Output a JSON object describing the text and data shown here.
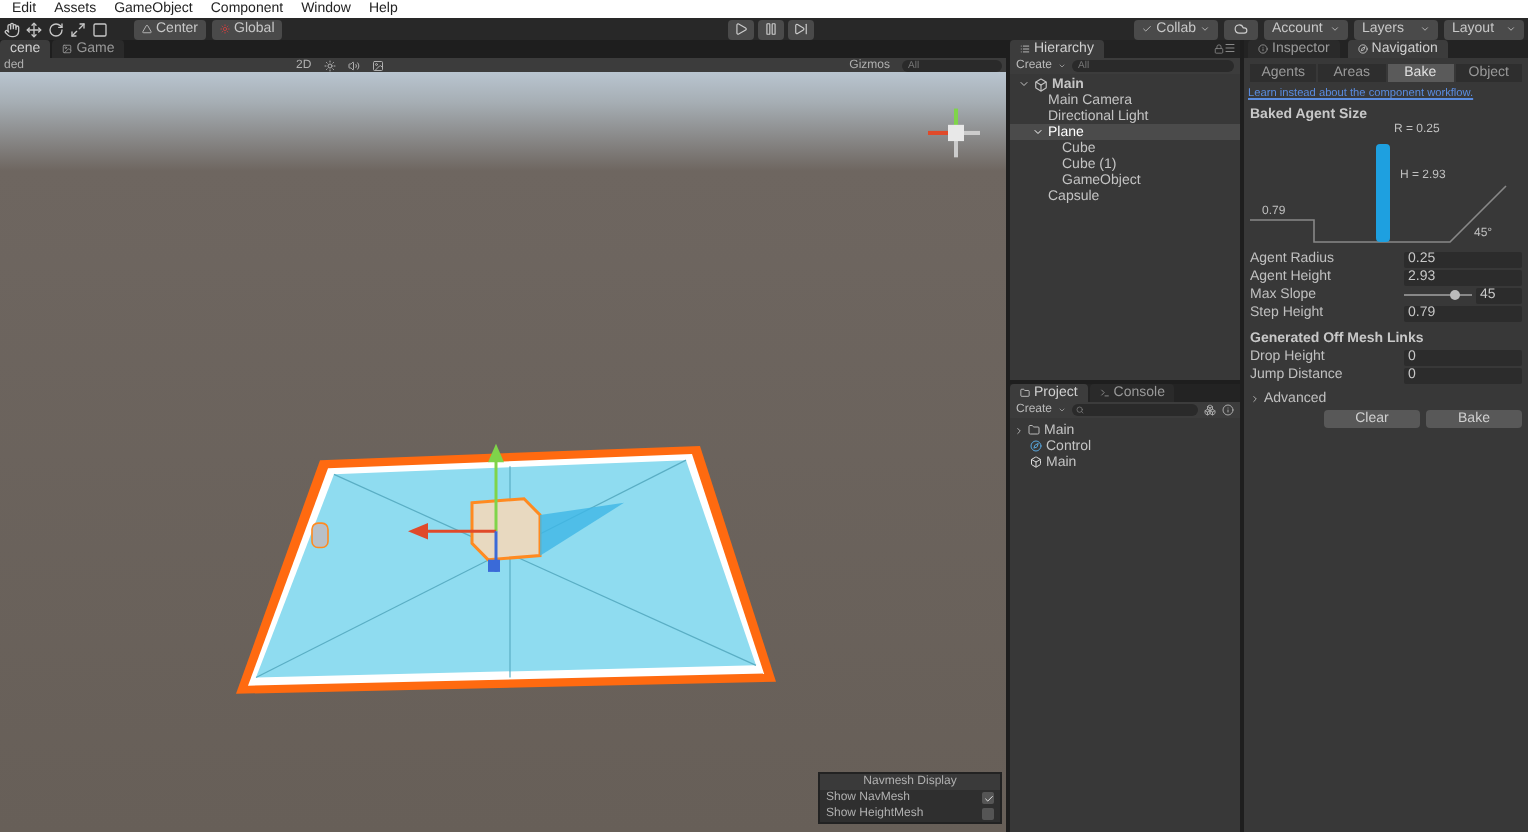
{
  "menu": [
    "Edit",
    "Assets",
    "GameObject",
    "Component",
    "Window",
    "Help"
  ],
  "toolbar": {
    "pivot": "Center",
    "space": "Global",
    "collab": "Collab",
    "account": "Account",
    "layers": "Layers",
    "layout": "Layout"
  },
  "scene": {
    "tabs": [
      {
        "label": "cene",
        "selected": true
      },
      {
        "label": "Game",
        "selected": false
      }
    ],
    "shading": "ded",
    "mode_2d": "2D",
    "gizmos": "Gizmos",
    "search_placeholder": "All"
  },
  "navmesh_display": {
    "title": "Navmesh Display",
    "options": [
      {
        "label": "Show NavMesh",
        "checked": true
      },
      {
        "label": "Show HeightMesh",
        "checked": false
      }
    ]
  },
  "hierarchy": {
    "title": "Hierarchy",
    "create": "Create",
    "search_placeholder": "All",
    "items": [
      {
        "label": "Main",
        "kind": "scene",
        "selected": false,
        "expanded": true,
        "children": [
          {
            "label": "Main Camera",
            "selected": false
          },
          {
            "label": "Directional Light",
            "selected": false
          },
          {
            "label": "Plane",
            "selected": true,
            "expanded": true,
            "children": [
              {
                "label": "Cube",
                "selected": false
              },
              {
                "label": "Cube (1)",
                "selected": false
              },
              {
                "label": "GameObject",
                "selected": false
              }
            ]
          },
          {
            "label": "Capsule",
            "selected": false
          }
        ]
      }
    ]
  },
  "project": {
    "tabs": [
      {
        "label": "Project",
        "selected": true
      },
      {
        "label": "Console",
        "selected": false
      }
    ],
    "create": "Create",
    "items": [
      {
        "label": "Main",
        "kind": "folder",
        "expanded": false
      },
      {
        "label": "Control",
        "kind": "asset"
      },
      {
        "label": "Main",
        "kind": "scene"
      }
    ]
  },
  "inspector": {
    "tabs": [
      {
        "label": "Inspector",
        "selected": false
      },
      {
        "label": "Navigation",
        "selected": true
      }
    ],
    "subtabs": [
      {
        "label": "Agents",
        "selected": false
      },
      {
        "label": "Areas",
        "selected": false
      },
      {
        "label": "Bake",
        "selected": true
      },
      {
        "label": "Object",
        "selected": false
      }
    ],
    "link": "Learn instead about the component workflow.",
    "agent_size": {
      "title": "Baked Agent Size",
      "radius_label": "R = 0.25",
      "height_label": "H = 2.93",
      "step_label": "0.79",
      "slope_label": "45°"
    },
    "fields": [
      {
        "label": "Agent Radius",
        "value": "0.25",
        "kind": "text"
      },
      {
        "label": "Agent Height",
        "value": "2.93",
        "kind": "text"
      },
      {
        "label": "Max Slope",
        "value": "45",
        "kind": "slider",
        "level": 0.75
      },
      {
        "label": "Step Height",
        "value": "0.79",
        "kind": "text"
      }
    ],
    "offmesh": {
      "title": "Generated Off Mesh Links",
      "fields": [
        {
          "label": "Drop Height",
          "value": "0"
        },
        {
          "label": "Jump Distance",
          "value": "0"
        }
      ]
    },
    "advanced": {
      "label": "Advanced",
      "expanded": false
    },
    "buttons": [
      "Clear",
      "Bake"
    ]
  }
}
